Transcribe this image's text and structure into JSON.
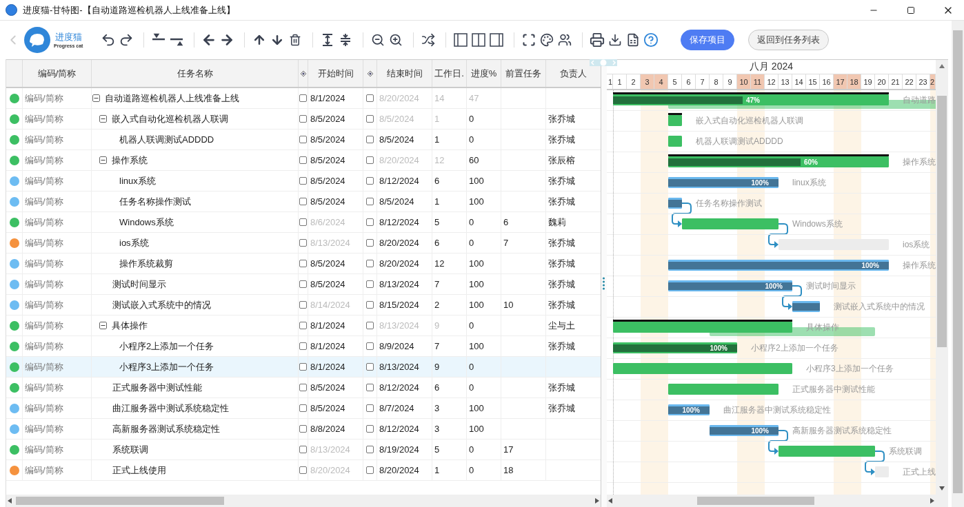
{
  "window": {
    "title": "进度猫-甘特图-【自动道路巡检机器人上线准备上线】"
  },
  "logo": {
    "name": "进度猫",
    "tagline": "Progress cat"
  },
  "toolbar": {
    "buttons": [
      {
        "label": "保存项目",
        "kind": "primary"
      },
      {
        "label": "返回到任务列表",
        "kind": "secondary"
      }
    ]
  },
  "columns": [
    "编码/简称",
    "任务名称",
    "开始时间",
    "结束时间",
    "工作日.",
    "进度%",
    "前置任务",
    "负责人"
  ],
  "timeline": {
    "month": "八月 2024",
    "days": [
      {
        "label": "1",
        "weekend": false
      },
      {
        "label": "1",
        "weekend": false
      },
      {
        "label": "2",
        "weekend": false
      },
      {
        "label": "3",
        "weekend": true
      },
      {
        "label": "4",
        "weekend": true
      },
      {
        "label": "5",
        "weekend": false
      },
      {
        "label": "6",
        "weekend": false
      },
      {
        "label": "7",
        "weekend": false
      },
      {
        "label": "8",
        "weekend": false
      },
      {
        "label": "9",
        "weekend": false
      },
      {
        "label": "10",
        "weekend": true
      },
      {
        "label": "11",
        "weekend": true
      },
      {
        "label": "12",
        "weekend": false
      },
      {
        "label": "13",
        "weekend": false
      },
      {
        "label": "14",
        "weekend": false
      },
      {
        "label": "15",
        "weekend": false
      },
      {
        "label": "16",
        "weekend": false
      },
      {
        "label": "17",
        "weekend": true
      },
      {
        "label": "18",
        "weekend": true
      },
      {
        "label": "19",
        "weekend": false
      },
      {
        "label": "20",
        "weekend": false
      },
      {
        "label": "21",
        "weekend": false
      },
      {
        "label": "22",
        "weekend": false
      },
      {
        "label": "23",
        "weekend": false
      },
      {
        "label": "2",
        "weekend": true
      }
    ]
  },
  "tasks": [
    {
      "color": "#3cbf63",
      "code": "编码/简称",
      "name": "自动道路巡检机器人上线准备上线",
      "expanded": true,
      "start": "8/1/2024",
      "start_checked": false,
      "start_muted": false,
      "end": "8/20/2024",
      "end_checked": false,
      "end_muted": true,
      "work": "14",
      "work_muted": true,
      "progress": "47",
      "progress_muted": true,
      "selected": false,
      "bar": {
        "kind": "summary",
        "level": 0.47,
        "text": "47%",
        "label": "自动道路",
        "baseline": true
      },
      "children": [
        {
          "color": "#3cbf63",
          "code": "编码/简称",
          "name": "嵌入式自动化巡检机器人联调",
          "expanded": true,
          "start": "8/5/2024",
          "start_checked": false,
          "start_muted": false,
          "end": "8/5/2024",
          "end_checked": false,
          "end_muted": true,
          "work": "1",
          "work_muted": true,
          "progress": "0",
          "progress_muted": false,
          "owner": "张乔城",
          "selected": false,
          "bar": {
            "kind": "summary",
            "label": "嵌入式自动化巡检机器人联调"
          },
          "children": [
            {
              "color": "#3cbf63",
              "code": "编码/简称",
              "name": "机器人联调测试ADDDD",
              "start": "8/5/2024",
              "start_checked": false,
              "start_muted": false,
              "end": "8/5/2024",
              "end_checked": false,
              "end_muted": false,
              "work": "1",
              "work_muted": false,
              "progress": "0",
              "progress_muted": false,
              "owner": "张乔城",
              "selected": false,
              "bar": {
                "kind": "active",
                "label": "机器人联调测试ADDDD"
              }
            }
          ]
        },
        {
          "color": "#3cbf63",
          "code": "编码/简称",
          "name": "操作系统",
          "expanded": true,
          "start": "8/5/2024",
          "start_checked": false,
          "start_muted": false,
          "end": "8/20/2024",
          "end_checked": false,
          "end_muted": true,
          "work": "12",
          "work_muted": true,
          "progress": "60",
          "progress_muted": false,
          "owner": "张辰榕",
          "selected": false,
          "bar": {
            "kind": "summary",
            "level": 0.6,
            "text": "60%",
            "label": "操作系统"
          },
          "children": [
            {
              "color": "#6dbcf2",
              "code": "编码/简称",
              "name": "linux系统",
              "start": "8/5/2024",
              "start_checked": false,
              "start_muted": false,
              "end": "8/12/2024",
              "end_checked": false,
              "end_muted": false,
              "work": "6",
              "work_muted": false,
              "progress": "100",
              "progress_muted": false,
              "owner": "张乔城",
              "selected": false,
              "bar": {
                "kind": "done",
                "level": 1,
                "text": "100%",
                "label": "linux系统"
              }
            },
            {
              "color": "#6dbcf2",
              "code": "编码/简称",
              "name": "任务名称操作测试",
              "start": "8/5/2024",
              "start_checked": false,
              "start_muted": false,
              "end": "8/5/2024",
              "end_checked": false,
              "end_muted": false,
              "work": "1",
              "work_muted": false,
              "progress": "100",
              "progress_muted": false,
              "owner": "张乔城",
              "selected": false,
              "bar": {
                "kind": "done",
                "level": 1,
                "label": "任务名称操作测试"
              }
            },
            {
              "color": "#3cbf63",
              "code": "编码/简称",
              "name": "Windows系统",
              "start": "8/6/2024",
              "start_checked": false,
              "start_muted": true,
              "end": "8/12/2024",
              "end_checked": false,
              "end_muted": false,
              "work": "5",
              "work_muted": false,
              "progress": "0",
              "progress_muted": false,
              "pre": "6",
              "owner": "魏莉",
              "selected": false,
              "bar": {
                "kind": "active",
                "label": "Windows系统"
              }
            },
            {
              "color": "#f5923e",
              "code": "编码/简称",
              "name": "ios系统",
              "start": "8/13/2024",
              "start_checked": false,
              "start_muted": true,
              "end": "8/20/2024",
              "end_checked": false,
              "end_muted": false,
              "work": "6",
              "work_muted": false,
              "progress": "0",
              "progress_muted": false,
              "pre": "7",
              "owner": "张乔城",
              "selected": false,
              "bar": {
                "kind": "pending",
                "label": "ios系统"
              }
            },
            {
              "color": "#6dbcf2",
              "code": "编码/简称",
              "name": "操作系统裁剪",
              "start": "8/5/2024",
              "start_checked": false,
              "start_muted": false,
              "end": "8/20/2024",
              "end_checked": false,
              "end_muted": false,
              "work": "12",
              "work_muted": false,
              "progress": "100",
              "progress_muted": false,
              "owner": "张乔城",
              "selected": false,
              "bar": {
                "kind": "done",
                "level": 1,
                "text": "100%",
                "label": "操作系统"
              }
            }
          ]
        },
        {
          "color": "#6dbcf2",
          "code": "编码/简称",
          "name": "测试时间显示",
          "start": "8/5/2024",
          "start_checked": false,
          "start_muted": false,
          "end": "8/13/2024",
          "end_checked": false,
          "end_muted": false,
          "work": "7",
          "work_muted": false,
          "progress": "100",
          "progress_muted": false,
          "owner": "张乔城",
          "selected": false,
          "bar": {
            "kind": "done",
            "level": 1,
            "text": "100%",
            "label": "测试时间显示"
          }
        },
        {
          "color": "#6dbcf2",
          "code": "编码/简称",
          "name": "测试嵌入式系统中的情况",
          "start": "8/14/2024",
          "start_checked": false,
          "start_muted": true,
          "end": "8/15/2024",
          "end_checked": false,
          "end_muted": false,
          "work": "2",
          "work_muted": false,
          "progress": "100",
          "progress_muted": false,
          "pre": "10",
          "owner": "张乔城",
          "selected": false,
          "bar": {
            "kind": "done",
            "level": 1,
            "label": "测试嵌入式系统中的情况"
          }
        },
        {
          "color": "#3cbf63",
          "code": "编码/简称",
          "name": "具体操作",
          "expanded": true,
          "start": "8/1/2024",
          "start_checked": false,
          "start_muted": false,
          "end": "8/13/2024",
          "end_checked": false,
          "end_muted": true,
          "work": "9",
          "work_muted": true,
          "progress": "0",
          "progress_muted": false,
          "owner": "尘与土",
          "selected": false,
          "bar": {
            "kind": "summary",
            "label": "具体操作",
            "baseline": true
          },
          "children": [
            {
              "color": "#3cbf63",
              "code": "编码/简称",
              "name": "小程序2上添加一个任务",
              "start": "8/1/2024",
              "start_checked": false,
              "start_muted": false,
              "end": "8/9/2024",
              "end_checked": false,
              "end_muted": false,
              "work": "7",
              "work_muted": false,
              "progress": "100",
              "progress_muted": false,
              "owner": "张乔城",
              "selected": false,
              "bar": {
                "kind": "active",
                "level": 1,
                "text": "100%",
                "label": "小程序2上添加一个任务"
              }
            },
            {
              "color": "#3cbf63",
              "code": "编码/简称",
              "name": "小程序3上添加一个任务",
              "start": "8/1/2024",
              "start_checked": false,
              "start_muted": false,
              "end": "8/13/2024",
              "end_checked": false,
              "end_muted": false,
              "work": "9",
              "work_muted": false,
              "progress": "0",
              "progress_muted": false,
              "selected": true,
              "bar": {
                "kind": "active",
                "label": "小程序3上添加一个任务"
              }
            }
          ]
        },
        {
          "color": "#3cbf63",
          "code": "编码/简称",
          "name": "正式服务器中测试性能",
          "start": "8/5/2024",
          "start_checked": false,
          "start_muted": false,
          "end": "8/12/2024",
          "end_checked": false,
          "end_muted": false,
          "work": "6",
          "work_muted": false,
          "progress": "0",
          "progress_muted": false,
          "owner": "张乔城",
          "selected": false,
          "bar": {
            "kind": "active",
            "label": "正式服务器中测试性能"
          }
        },
        {
          "color": "#6dbcf2",
          "code": "编码/简称",
          "name": "曲江服务器中测试系统稳定性",
          "start": "8/5/2024",
          "start_checked": false,
          "start_muted": false,
          "end": "8/7/2024",
          "end_checked": false,
          "end_muted": false,
          "work": "3",
          "work_muted": false,
          "progress": "100",
          "progress_muted": false,
          "owner": "张乔城",
          "selected": false,
          "bar": {
            "kind": "done",
            "level": 1,
            "text": "100%",
            "label": "曲江服务器中测试系统稳定性"
          }
        },
        {
          "color": "#6dbcf2",
          "code": "编码/简称",
          "name": "高新服务器测试系统稳定性",
          "start": "8/8/2024",
          "start_checked": false,
          "start_muted": false,
          "end": "8/12/2024",
          "end_checked": false,
          "end_muted": false,
          "work": "3",
          "work_muted": false,
          "progress": "100",
          "progress_muted": false,
          "selected": false,
          "bar": {
            "kind": "done",
            "level": 1,
            "text": "100%",
            "label": "高新服务器测试系统稳定性"
          }
        },
        {
          "color": "#3cbf63",
          "code": "编码/简称",
          "name": "系统联调",
          "start": "8/13/2024",
          "start_checked": false,
          "start_muted": true,
          "end": "8/19/2024",
          "end_checked": false,
          "end_muted": false,
          "work": "5",
          "work_muted": false,
          "progress": "0",
          "progress_muted": false,
          "pre": "17",
          "selected": false,
          "bar": {
            "kind": "active",
            "label": "系统联调"
          }
        },
        {
          "color": "#f5923e",
          "code": "编码/简称",
          "name": "正式上线使用",
          "start": "8/20/2024",
          "start_checked": false,
          "start_muted": true,
          "end": "8/20/2024",
          "end_checked": false,
          "end_muted": false,
          "work": "1",
          "work_muted": false,
          "progress": "0",
          "progress_muted": false,
          "pre": "18",
          "selected": false,
          "bar": {
            "kind": "pending",
            "label": "正式上线"
          }
        }
      ]
    }
  ]
}
